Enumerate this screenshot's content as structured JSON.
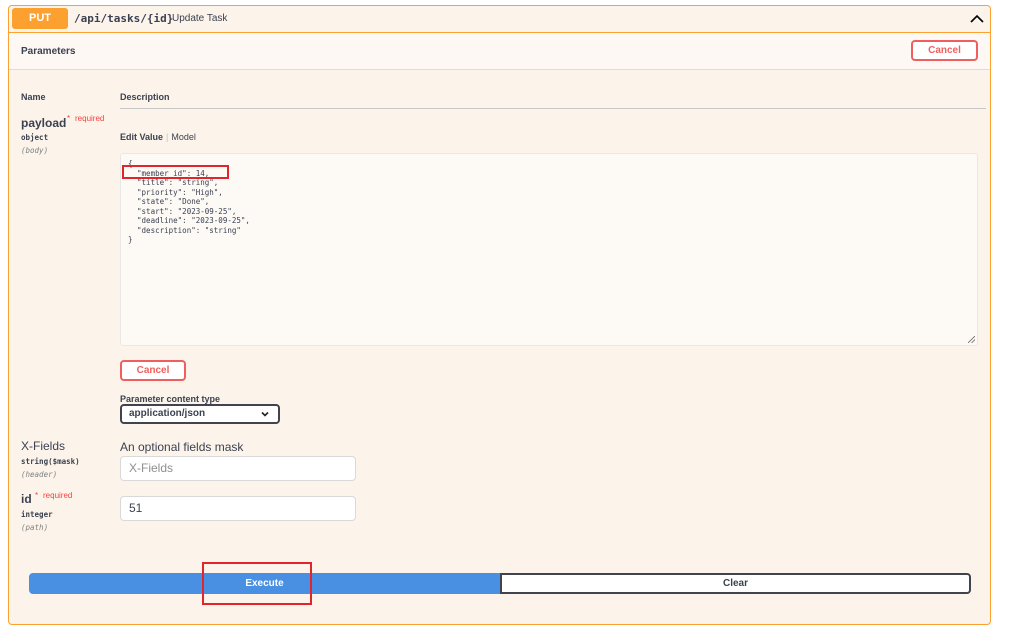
{
  "operation": {
    "method": "PUT",
    "path": "/api/tasks/{id}",
    "summary": "Update Task"
  },
  "parameters_section": {
    "title": "Parameters",
    "cancel_label": "Cancel"
  },
  "columns": {
    "name": "Name",
    "description": "Description"
  },
  "payload": {
    "name": "payload",
    "required_marker": "*",
    "required_label": "required",
    "type": "object",
    "in": "(body)",
    "tab_edit_value": "Edit Value",
    "tab_separator": "|",
    "tab_model": "Model",
    "body": "{\n  \"member_id\": 14,\n  \"title\": \"string\",\n  \"priority\": \"High\",\n  \"state\": \"Done\",\n  \"start\": \"2023-09-25\",\n  \"deadline\": \"2023-09-25\",\n  \"description\": \"string\"\n}",
    "cancel_label": "Cancel",
    "content_type_label": "Parameter content type",
    "content_type_value": "application/json"
  },
  "x_fields": {
    "name": "X-Fields",
    "type": "string($mask)",
    "in": "(header)",
    "description": "An optional fields mask",
    "placeholder": "X-Fields"
  },
  "id_param": {
    "name": "id",
    "required_marker": "*",
    "required_label": "required",
    "type": "integer",
    "in": "(path)",
    "value": "51"
  },
  "actions": {
    "execute_label": "Execute",
    "clear_label": "Clear"
  },
  "colors": {
    "put_accent": "#fca130",
    "execute_blue": "#4990e2",
    "cancel_red": "#f05f5f",
    "highlight_red": "#e0262c"
  },
  "icons": {
    "collapse": "chevron-up-icon",
    "select": "chevron-down-icon",
    "resize": "resize-handle-icon"
  }
}
